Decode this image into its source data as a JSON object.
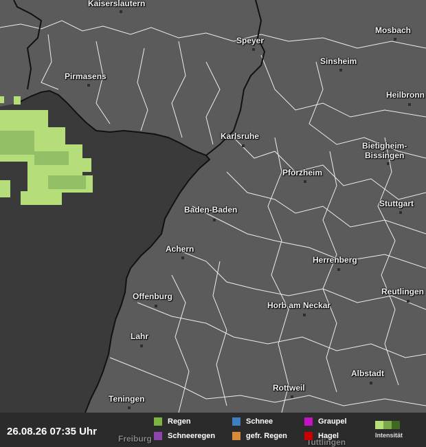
{
  "timestamp": "26.08.26 07:35 Uhr",
  "cities": [
    {
      "id": "kaiserslautern",
      "name": "Kaiserslautern"
    },
    {
      "id": "speyer",
      "name": "Speyer"
    },
    {
      "id": "mosbach",
      "name": "Mosbach"
    },
    {
      "id": "pirmasens",
      "name": "Pirmasens"
    },
    {
      "id": "sinsheim",
      "name": "Sinsheim"
    },
    {
      "id": "heilbronn",
      "name": "Heilbronn"
    },
    {
      "id": "karlsruhe",
      "name": "Karlsruhe"
    },
    {
      "id": "bietigheim",
      "name": "Bietigheim-\nBissingen"
    },
    {
      "id": "pforzheim",
      "name": "Pforzheim"
    },
    {
      "id": "baden-baden",
      "name": "Baden-Baden"
    },
    {
      "id": "stuttgart",
      "name": "Stuttgart"
    },
    {
      "id": "achern",
      "name": "Achern"
    },
    {
      "id": "herrenberg",
      "name": "Herrenberg"
    },
    {
      "id": "reutlingen",
      "name": "Reutlingen"
    },
    {
      "id": "offenburg",
      "name": "Offenburg"
    },
    {
      "id": "horb",
      "name": "Horb am Neckar"
    },
    {
      "id": "lahr",
      "name": "Lahr"
    },
    {
      "id": "albstadt",
      "name": "Albstadt"
    },
    {
      "id": "rottweil",
      "name": "Rottweil"
    },
    {
      "id": "teningen",
      "name": "Teningen"
    },
    {
      "id": "freiburg",
      "name": "Freiburg"
    },
    {
      "id": "tuttlingen",
      "name": "Tuttlingen"
    }
  ],
  "legend": {
    "items": [
      {
        "label": "Regen",
        "color": "#7cb342"
      },
      {
        "label": "Schneeregen",
        "color": "#8e44ad"
      },
      {
        "label": "Schnee",
        "color": "#3d7fc1"
      },
      {
        "label": "gefr. Regen",
        "color": "#d98a3a"
      },
      {
        "label": "Graupel",
        "color": "#c512c5"
      },
      {
        "label": "Hagel",
        "color": "#cc0000"
      }
    ],
    "intensity_label": "Intensität",
    "intensity_colors": [
      "#b7e07a",
      "#7aa84a",
      "#3d6a1e"
    ]
  },
  "colors": {
    "germany_land": "#5b5b5b",
    "france_land": "#3a3a3a",
    "rain_light": "#b5de7a",
    "rain_mid": "#8fbf5a"
  }
}
